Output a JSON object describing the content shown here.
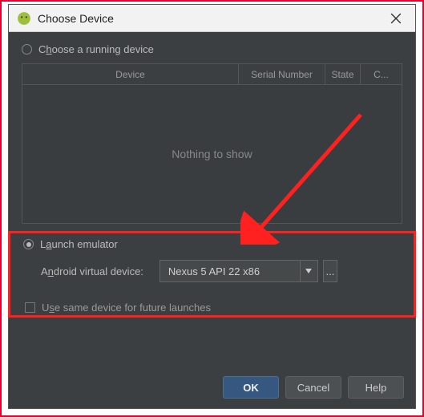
{
  "window": {
    "title": "Choose Device"
  },
  "options": {
    "running_label_pre": "C",
    "running_label_mnemonic": "h",
    "running_label_post": "oose a running device",
    "launch_label_pre": "L",
    "launch_label_mnemonic": "a",
    "launch_label_post": "unch emulator"
  },
  "table": {
    "headers": [
      "Device",
      "Serial Number",
      "State",
      "C..."
    ],
    "empty_text": "Nothing to show"
  },
  "avd": {
    "label_pre": "A",
    "label_mnemonic": "n",
    "label_post": "droid virtual device:",
    "selected": "Nexus 5 API 22 x86",
    "browse": "..."
  },
  "remember": {
    "label_pre": "U",
    "label_mnemonic": "s",
    "label_post": "e same device for future launches"
  },
  "buttons": {
    "ok": "OK",
    "cancel": "Cancel",
    "help": "Help"
  }
}
